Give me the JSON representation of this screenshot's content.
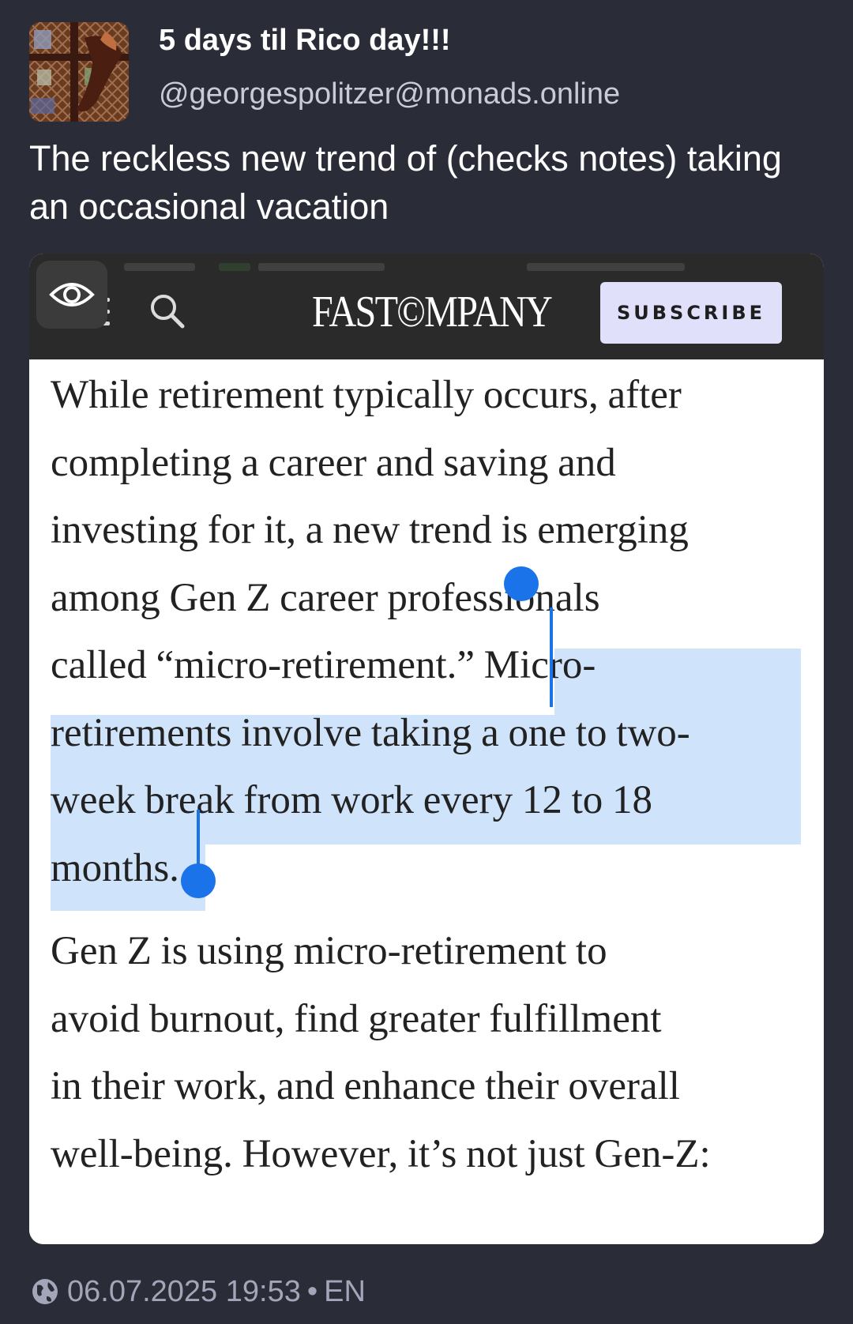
{
  "post": {
    "display_name": "5 days til Rico day!!!",
    "handle": "@georgespolitzer@monads.online",
    "text": "The reckless new trend of (checks notes) taking an occasional vacation",
    "avatar_icon": "artwork-avatar"
  },
  "media": {
    "sensitive_toggle_icon": "eye-icon",
    "menu_icon": "hamburger-icon",
    "search_icon": "search-icon",
    "logo_text": "FAST©MPANY",
    "subscribe_label": "SUBSCRIBE",
    "article": {
      "paragraph_1_lines": [
        "While retirement typically occurs, after",
        "completing a career and saving and",
        "investing for it, a new trend is emerging",
        "among Gen Z career professionals",
        "called “micro-retirement.” Micro-",
        "retirements involve taking a one to two-",
        "week break from work every 12 to 18",
        "months."
      ],
      "paragraph_2_lines": [
        "Gen Z is using micro-retirement to",
        "avoid burnout, find greater fulfillment",
        "in their work, and enhance their overall",
        "well-being. However, it’s not just Gen-Z:"
      ],
      "selected_text": "Micro-retirements involve taking a one to two-week break from work every 12 to 18 months."
    }
  },
  "footer": {
    "visibility_icon": "globe-icon",
    "timestamp": "06.07.2025 19:53",
    "separator": "•",
    "language": "EN"
  },
  "colors": {
    "background": "#2a2c38",
    "selection_highlight": "#cfe3fa",
    "selection_handle": "#1a73e8",
    "subscribe_bg": "#e0e0fb"
  }
}
